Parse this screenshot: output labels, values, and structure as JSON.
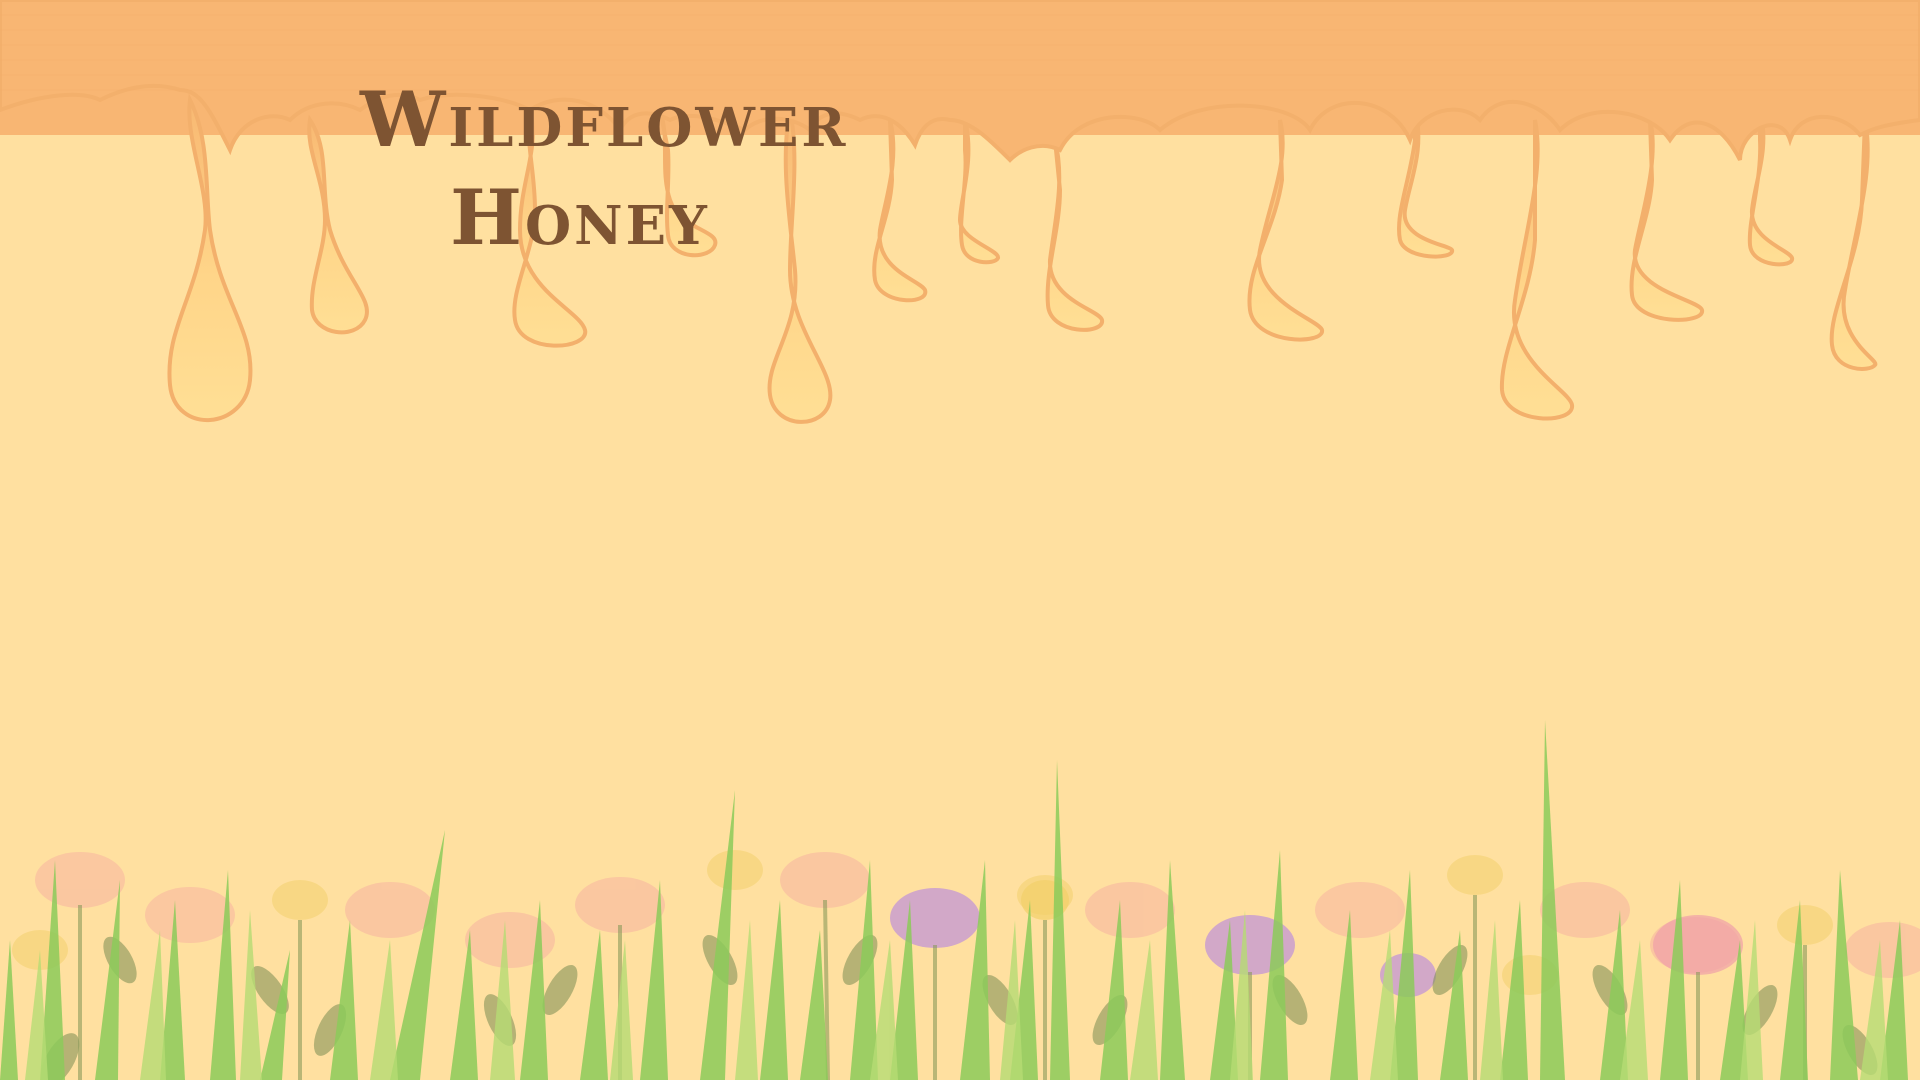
{
  "title": {
    "line1": "Wildflower",
    "line2": "Honey"
  },
  "colors": {
    "background": "#FFE0A0",
    "honey_top": "#F7B36F",
    "honey_drip": "#FFD27C",
    "title_text": "#7E5432",
    "grass": "#8CCB5A",
    "flower_pink": "#F7B0A0",
    "flower_purple": "#C79AD2",
    "flower_yellow": "#F2D06A"
  },
  "decorations": {
    "top_band": "dripping-honey",
    "bottom_band": "wildflower-meadow"
  }
}
